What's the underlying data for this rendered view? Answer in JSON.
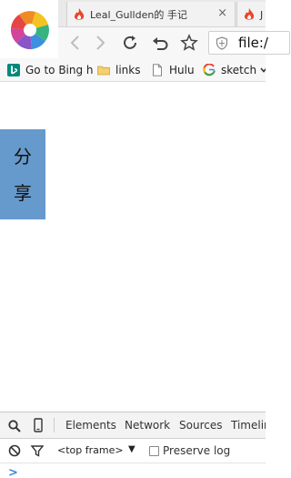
{
  "browser": {
    "tabs": [
      {
        "title": "Leal_Gullden的 手记",
        "close_glyph": "×"
      },
      {
        "title": "J"
      }
    ],
    "address": {
      "url_text": "file:/"
    },
    "bookmarks": [
      {
        "label": "Go to Bing h",
        "icon": "bing-icon"
      },
      {
        "label": "links",
        "icon": "folder-icon"
      },
      {
        "label": "Hulu",
        "icon": "page-icon"
      },
      {
        "label": "sketch",
        "icon": "google-icon"
      }
    ]
  },
  "page": {
    "share_chars": [
      "分",
      "享"
    ],
    "share_color": "#6699cc"
  },
  "devtools": {
    "tabs": [
      "Elements",
      "Network",
      "Sources",
      "Timelin"
    ],
    "frame_select": "<top frame>",
    "frame_arrow": "▼",
    "preserve_log_label": "Preserve log",
    "console_prompt": ">"
  },
  "colors": {
    "flame": "#e8472c",
    "tabstrip": "#e9e9e9",
    "toolbar": "#f7f7f7",
    "prompt": "#3a8ad8"
  }
}
